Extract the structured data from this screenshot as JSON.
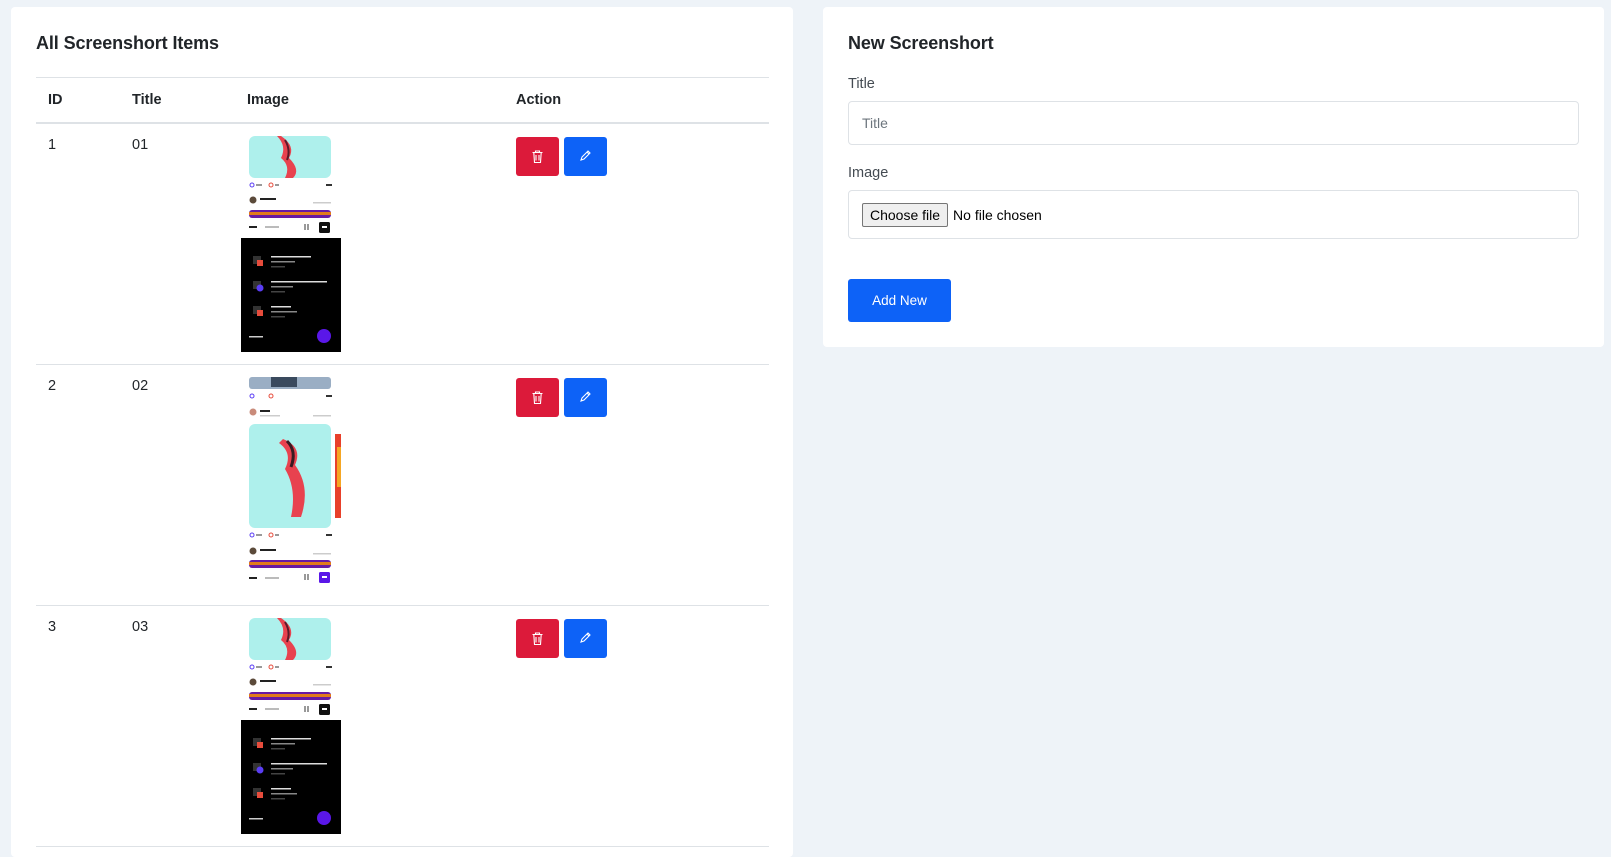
{
  "list": {
    "title": "All Screenshort Items",
    "columns": [
      "ID",
      "Title",
      "Image",
      "Action"
    ],
    "rows": [
      {
        "id": "1",
        "title": "01",
        "image": "feed-thumbnail"
      },
      {
        "id": "2",
        "title": "02",
        "image": "post-thumbnail"
      },
      {
        "id": "3",
        "title": "03",
        "image": "feed-thumbnail"
      }
    ],
    "delete_icon": "trash-icon",
    "edit_icon": "pencil-icon"
  },
  "form": {
    "title": "New Screenshort",
    "title_label": "Title",
    "title_placeholder": "Title",
    "image_label": "Image",
    "file_button": "Choose file",
    "file_status": "No file chosen",
    "submit_label": "Add New"
  },
  "colors": {
    "delete": "#dc1a3a",
    "primary": "#0d62f7",
    "background": "#eef3f8"
  }
}
